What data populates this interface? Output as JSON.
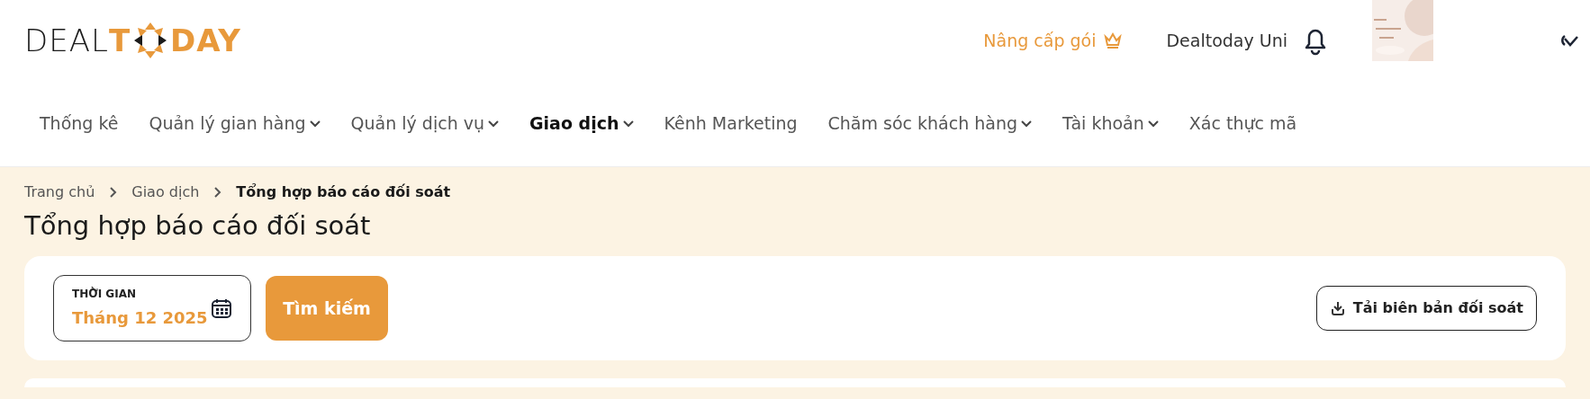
{
  "logo": {
    "left": "DEAL",
    "middle": "T",
    "right": "DAY"
  },
  "header": {
    "upgrade": "Nâng cấp gói",
    "user_name": "Dealtoday Uni"
  },
  "nav": [
    {
      "label": "Thống kê",
      "has_menu": false,
      "selected": false
    },
    {
      "label": "Quản lý gian hàng",
      "has_menu": true,
      "selected": false
    },
    {
      "label": "Quản lý dịch vụ",
      "has_menu": true,
      "selected": false
    },
    {
      "label": "Giao dịch",
      "has_menu": true,
      "selected": true
    },
    {
      "label": "Kênh Marketing",
      "has_menu": false,
      "selected": false
    },
    {
      "label": "Chăm sóc khách hàng",
      "has_menu": true,
      "selected": false
    },
    {
      "label": "Tài khoản",
      "has_menu": true,
      "selected": false
    },
    {
      "label": "Xác thực mã",
      "has_menu": false,
      "selected": false
    }
  ],
  "breadcrumb": [
    {
      "label": "Trang chủ",
      "current": false
    },
    {
      "label": "Giao dịch",
      "current": false
    },
    {
      "label": "Tổng hợp báo cáo đối soát",
      "current": true
    }
  ],
  "page_title": "Tổng hợp báo cáo đối soát",
  "filters": {
    "period": {
      "label": "THỜI GIAN",
      "value": "Tháng 12 2025"
    },
    "search_button": "Tìm kiếm",
    "download_button": "Tải biên bản đối soát"
  }
}
